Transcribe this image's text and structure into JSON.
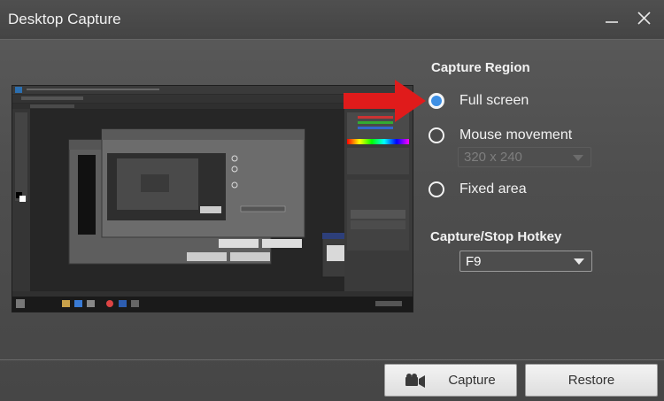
{
  "window": {
    "title": "Desktop Capture"
  },
  "capture_region": {
    "title": "Capture Region",
    "options": [
      {
        "label": "Full screen",
        "checked": true
      },
      {
        "label": "Mouse movement",
        "checked": false
      },
      {
        "label": "Fixed area",
        "checked": false
      }
    ],
    "size_select": {
      "value": "320 x 240",
      "disabled": true
    }
  },
  "hotkey": {
    "title": "Capture/Stop Hotkey",
    "value": "F9"
  },
  "buttons": {
    "capture": "Capture",
    "restore": "Restore"
  },
  "colors": {
    "accent": "#3d8fe4",
    "arrow": "#e01b1b"
  }
}
